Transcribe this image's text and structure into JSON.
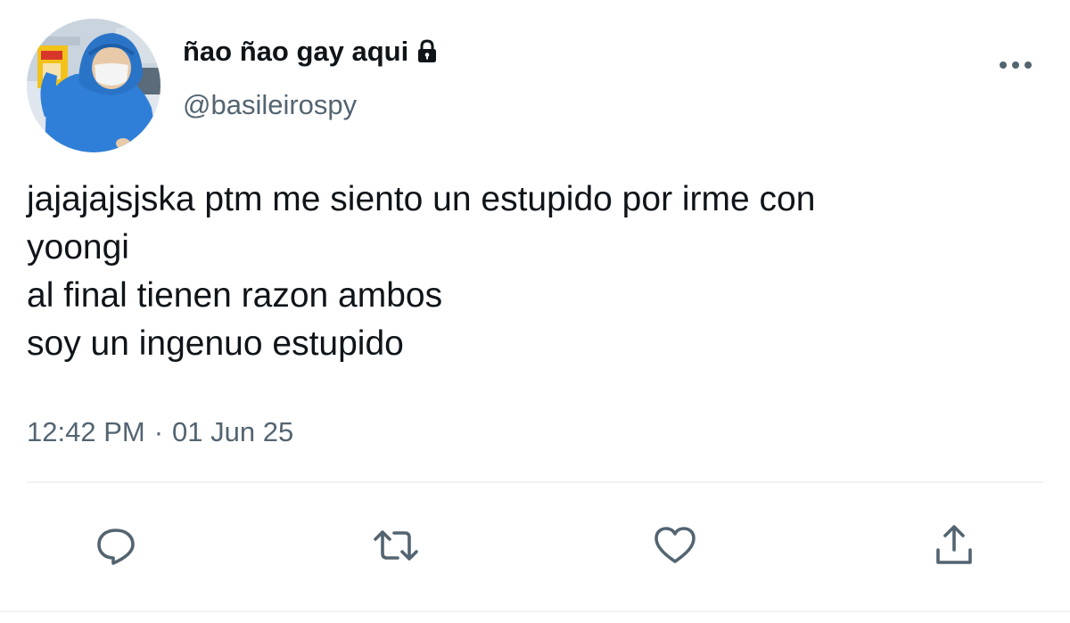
{
  "user": {
    "display_name": "ñao ñao gay aqui",
    "handle": "@basileirospy",
    "protected": true,
    "avatar": "person-in-blue-raincoat-with-mask"
  },
  "tweet": {
    "lines": [
      "jajajajsjska ptm me siento un estupido por irme con",
      "yoongi",
      "al final tienen razon ambos",
      "soy un ingenuo estupido"
    ],
    "time": "12:42 PM",
    "separator": "·",
    "date": "01 Jun 25"
  },
  "actions": {
    "icons": [
      "reply-icon",
      "retweet-icon",
      "like-icon",
      "share-icon"
    ]
  },
  "colors": {
    "text": "#0f1419",
    "secondary": "#536471",
    "divider": "#eff3f4",
    "avatar_raincoat": "#2f7fd8"
  }
}
